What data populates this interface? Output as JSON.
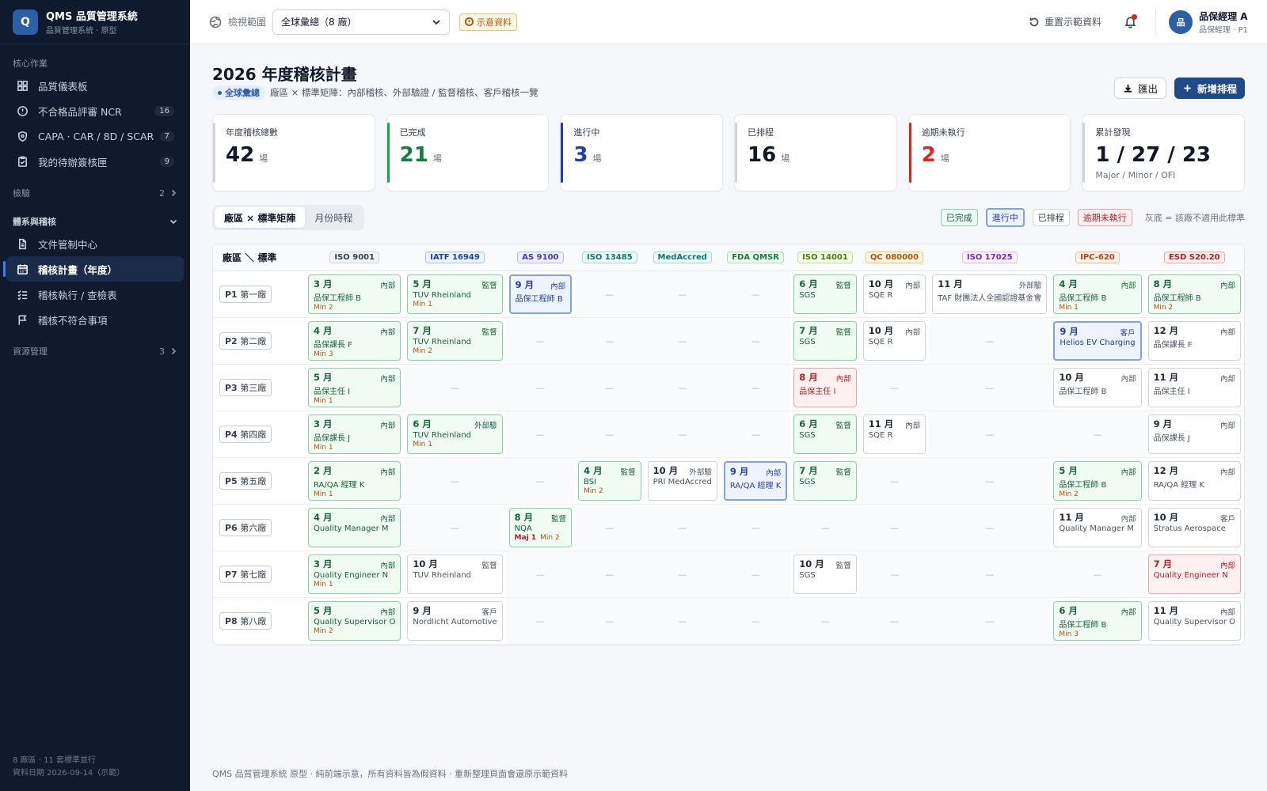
{
  "app": {
    "name": "QMS 品質管理系統",
    "subtitle": "品質管理系統 · 原型",
    "logo": "Q"
  },
  "sidebar": {
    "section_core": "核心作業",
    "core_items": [
      {
        "label": "品質儀表板",
        "icon": "dashboard-icon"
      },
      {
        "label": "不合格品評審 NCR",
        "icon": "alert-circle-icon",
        "badge": "16"
      },
      {
        "label": "CAPA · CAR / 8D / SCAR",
        "icon": "shield-icon",
        "badge": "7"
      },
      {
        "label": "我的待辦簽核匣",
        "icon": "clipboard-check-icon",
        "badge": "9"
      }
    ],
    "section_inspection": "檢驗",
    "section_inspection_count": "2",
    "section_system": "體系與稽核",
    "system_items": [
      {
        "label": "文件管制中心",
        "icon": "document-icon"
      },
      {
        "label": "稽核計畫（年度）",
        "icon": "calendar-icon",
        "active": true
      },
      {
        "label": "稽核執行 / 查檢表",
        "icon": "checklist-icon"
      },
      {
        "label": "稽核不符合事項",
        "icon": "flag-icon"
      }
    ],
    "section_resource": "資源管理",
    "section_resource_count": "3",
    "footer_line1": "8 廠區 · 11 套標準並行",
    "footer_line2": "資料日期 2026-09-14（示範）"
  },
  "topbar": {
    "scope_label": "檢視範圍",
    "scope_value": "全球彙總（8 廠）",
    "demo_badge": "示意資料",
    "reset_label": "重置示範資料",
    "user_initial": "品",
    "user_name": "品保經理 A",
    "user_role": "品保經理 · P1"
  },
  "page": {
    "title": "2026 年度稽核計畫",
    "scope_pill": "全球彙總",
    "subtitle": "廠區 × 標準矩陣：內部稽核、外部驗證 / 監督稽核、客戶稽核一覽",
    "export_label": "匯出",
    "add_label": "新增排程"
  },
  "kpis": [
    {
      "label": "年度稽核總數",
      "value": "42",
      "unit": "場",
      "accent": "#d1d5db",
      "value_color": "#111827"
    },
    {
      "label": "已完成",
      "value": "21",
      "unit": "場",
      "accent": "#16a34a",
      "value_color": "#15803d"
    },
    {
      "label": "進行中",
      "value": "3",
      "unit": "場",
      "accent": "#1e40af",
      "value_color": "#1e40af"
    },
    {
      "label": "已排程",
      "value": "16",
      "unit": "場",
      "accent": "#d1d5db",
      "value_color": "#111827"
    },
    {
      "label": "逾期未執行",
      "value": "2",
      "unit": "場",
      "accent": "#dc2626",
      "value_color": "#dc2626"
    },
    {
      "label": "累計發現",
      "value": "1 / 27 / 23",
      "unit": "",
      "sub": "Major / Minor / OFI",
      "accent": "#d1d5db",
      "value_color": "#111827"
    }
  ],
  "view_tabs": [
    "廠區 × 標準矩陣",
    "月份時程"
  ],
  "legend": {
    "done": "已完成",
    "in_progress": "進行中",
    "planned": "已排程",
    "overdue": "逾期未執行",
    "note": "灰底 = 該廠不適用此標準"
  },
  "matrix": {
    "corner": "廠區 ＼ 標準",
    "standards": [
      {
        "name": "ISO 9001",
        "color": "#374151",
        "bg": "#f3f4f6",
        "border": "#d1d5db"
      },
      {
        "name": "IATF 16949",
        "color": "#1e40af",
        "bg": "#eef4ff",
        "border": "#a9c1f0"
      },
      {
        "name": "AS 9100",
        "color": "#4338ca",
        "bg": "#eef0ff",
        "border": "#b7bcf0"
      },
      {
        "name": "ISO 13485",
        "color": "#0f766e",
        "bg": "#ecfdf7",
        "border": "#9ed9c6"
      },
      {
        "name": "MedAccred",
        "color": "#0f766e",
        "bg": "#ecfdf7",
        "border": "#9ed9c6"
      },
      {
        "name": "FDA QMSR",
        "color": "#15803d",
        "bg": "#f0fbf4",
        "border": "#a7dcb7"
      },
      {
        "name": "ISO 14001",
        "color": "#4d7c0f",
        "bg": "#f5fbe8",
        "border": "#c2de8f"
      },
      {
        "name": "QC 080000",
        "color": "#b45309",
        "bg": "#fff7e6",
        "border": "#f5c26b"
      },
      {
        "name": "ISO 17025",
        "color": "#7e22ce",
        "bg": "#faf5ff",
        "border": "#d8b4fe"
      },
      {
        "name": "IPC-620",
        "color": "#c2410c",
        "bg": "#fff4ed",
        "border": "#f9b98c"
      },
      {
        "name": "ESD S20.20",
        "color": "#b91c1c",
        "bg": "#fff1f1",
        "border": "#f3a3a3"
      }
    ],
    "rows": [
      {
        "code": "P1",
        "name": "第一廠",
        "cells": [
          {
            "m": "3 月",
            "t": "內部",
            "who": "品保工程師 B",
            "min": "Min 2",
            "s": "done"
          },
          {
            "m": "5 月",
            "t": "監督",
            "who": "TÜV Rheinland",
            "min": "Min 1",
            "s": "done"
          },
          {
            "m": "9 月",
            "t": "內部",
            "who": "品保工程師 B",
            "s": "prog"
          },
          null,
          null,
          null,
          {
            "m": "6 月",
            "t": "監督",
            "who": "SGS",
            "s": "done"
          },
          {
            "m": "10 月",
            "t": "內部",
            "who": "SQE R",
            "s": "plan"
          },
          {
            "m": "11 月",
            "t": "外部驗",
            "who": "TAF 財團法人全國認證基金會",
            "s": "plan"
          },
          {
            "m": "4 月",
            "t": "內部",
            "who": "品保工程師 B",
            "min": "Min 1",
            "s": "done"
          },
          {
            "m": "8 月",
            "t": "內部",
            "who": "品保工程師 B",
            "min": "Min 2",
            "s": "done"
          }
        ]
      },
      {
        "code": "P2",
        "name": "第二廠",
        "cells": [
          {
            "m": "4 月",
            "t": "內部",
            "who": "品保課長 F",
            "min": "Min 3",
            "s": "done"
          },
          {
            "m": "7 月",
            "t": "監督",
            "who": "TÜV Rheinland",
            "min": "Min 2",
            "s": "done"
          },
          null,
          null,
          null,
          null,
          {
            "m": "7 月",
            "t": "監督",
            "who": "SGS",
            "s": "done"
          },
          {
            "m": "10 月",
            "t": "內部",
            "who": "SQE R",
            "s": "plan"
          },
          null,
          {
            "m": "9 月",
            "t": "客戶",
            "who": "Helios EV Charging",
            "s": "prog"
          },
          {
            "m": "12 月",
            "t": "內部",
            "who": "品保課長 F",
            "s": "plan"
          }
        ]
      },
      {
        "code": "P3",
        "name": "第三廠",
        "cells": [
          {
            "m": "5 月",
            "t": "內部",
            "who": "品保主任 I",
            "min": "Min 1",
            "s": "done"
          },
          null,
          null,
          null,
          null,
          null,
          {
            "m": "8 月",
            "t": "內部",
            "who": "品保主任 I",
            "s": "over"
          },
          null,
          null,
          {
            "m": "10 月",
            "t": "內部",
            "who": "品保工程師 B",
            "s": "plan"
          },
          {
            "m": "11 月",
            "t": "內部",
            "who": "品保主任 I",
            "s": "plan"
          }
        ]
      },
      {
        "code": "P4",
        "name": "第四廠",
        "cells": [
          {
            "m": "3 月",
            "t": "內部",
            "who": "品保課長 J",
            "min": "Min 1",
            "s": "done"
          },
          {
            "m": "6 月",
            "t": "外部驗",
            "who": "TÜV Rheinland",
            "min": "Min 1",
            "s": "done"
          },
          null,
          null,
          null,
          null,
          {
            "m": "6 月",
            "t": "監督",
            "who": "SGS",
            "s": "done"
          },
          {
            "m": "11 月",
            "t": "內部",
            "who": "SQE R",
            "s": "plan"
          },
          null,
          null,
          {
            "m": "9 月",
            "t": "內部",
            "who": "品保課長 J",
            "s": "plan"
          }
        ]
      },
      {
        "code": "P5",
        "name": "第五廠",
        "cells": [
          {
            "m": "2 月",
            "t": "內部",
            "who": "RA/QA 經理 K",
            "min": "Min 1",
            "s": "done"
          },
          null,
          null,
          {
            "m": "4 月",
            "t": "監督",
            "who": "BSI",
            "min": "Min 2",
            "s": "done"
          },
          {
            "m": "10 月",
            "t": "外部驗",
            "who": "PRI MedAccred",
            "s": "plan"
          },
          {
            "m": "9 月",
            "t": "內部",
            "who": "RA/QA 經理 K",
            "s": "prog"
          },
          {
            "m": "7 月",
            "t": "監督",
            "who": "SGS",
            "s": "done"
          },
          null,
          null,
          {
            "m": "5 月",
            "t": "內部",
            "who": "品保工程師 B",
            "min": "Min 2",
            "s": "done"
          },
          {
            "m": "12 月",
            "t": "內部",
            "who": "RA/QA 經理 K",
            "s": "plan"
          }
        ]
      },
      {
        "code": "P6",
        "name": "第六廠",
        "cells": [
          {
            "m": "4 月",
            "t": "內部",
            "who": "Quality Manager M",
            "s": "done"
          },
          null,
          {
            "m": "8 月",
            "t": "監督",
            "who": "NQA",
            "maj": "Maj 1",
            "min": "Min 2",
            "s": "done"
          },
          null,
          null,
          null,
          null,
          null,
          null,
          {
            "m": "11 月",
            "t": "內部",
            "who": "Quality Manager M",
            "s": "plan"
          },
          {
            "m": "10 月",
            "t": "客戶",
            "who": "Stratus Aerospace",
            "s": "plan"
          }
        ]
      },
      {
        "code": "P7",
        "name": "第七廠",
        "cells": [
          {
            "m": "3 月",
            "t": "內部",
            "who": "Quality Engineer N",
            "min": "Min 1",
            "s": "done"
          },
          {
            "m": "10 月",
            "t": "監督",
            "who": "TÜV Rheinland",
            "s": "plan"
          },
          null,
          null,
          null,
          null,
          {
            "m": "10 月",
            "t": "監督",
            "who": "SGS",
            "s": "plan"
          },
          null,
          null,
          null,
          {
            "m": "7 月",
            "t": "內部",
            "who": "Quality Engineer N",
            "s": "over"
          }
        ]
      },
      {
        "code": "P8",
        "name": "第八廠",
        "cells": [
          {
            "m": "5 月",
            "t": "內部",
            "who": "Quality Supervisor O",
            "min": "Min 2",
            "s": "done"
          },
          {
            "m": "9 月",
            "t": "客戶",
            "who": "Nordlicht Automotive",
            "s": "plan"
          },
          null,
          null,
          null,
          null,
          null,
          null,
          null,
          {
            "m": "6 月",
            "t": "內部",
            "who": "品保工程師 B",
            "min": "Min 3",
            "s": "done"
          },
          {
            "m": "11 月",
            "t": "內部",
            "who": "Quality Supervisor O",
            "s": "plan"
          }
        ]
      }
    ],
    "dash": "—"
  },
  "footer": "QMS 品質管理系統 原型 · 純前端示意，所有資料皆為假資料 · 重新整理頁面會還原示範資料"
}
